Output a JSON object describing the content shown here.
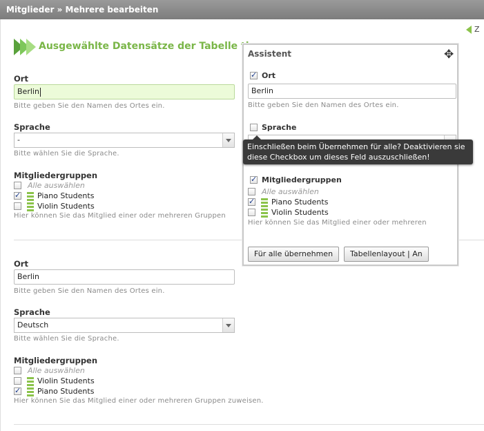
{
  "header": {
    "title": "Mitglieder » Mehrere bearbeiten"
  },
  "back_link": {
    "label": "Z"
  },
  "section": {
    "title": "Ausgewählte Datensätze der Tabelle th"
  },
  "records": [
    {
      "ort_label": "Ort",
      "ort_value": "Berlin",
      "ort_hint": "Bitte geben Sie den Namen des Ortes ein.",
      "sprache_label": "Sprache",
      "sprache_value": "-",
      "sprache_hint": "Bitte wählen Sie die Sprache.",
      "gruppen_label": "Mitgliedergruppen",
      "select_all": "Alle auswählen",
      "groups": [
        {
          "name": "Piano Students",
          "checked": true
        },
        {
          "name": "Violin Students",
          "checked": false
        }
      ],
      "gruppen_hint": "Hier können Sie das Mitglied einer oder mehreren Gruppen"
    },
    {
      "ort_label": "Ort",
      "ort_value": "Berlin",
      "ort_hint": "Bitte geben Sie den Namen des Ortes ein.",
      "sprache_label": "Sprache",
      "sprache_value": "Deutsch",
      "sprache_hint": "Bitte wählen Sie die Sprache.",
      "gruppen_label": "Mitgliedergruppen",
      "select_all": "Alle auswählen",
      "groups": [
        {
          "name": "Violin Students",
          "checked": false
        },
        {
          "name": "Piano Students",
          "checked": true
        }
      ],
      "gruppen_hint": "Hier können Sie das Mitglied einer oder mehreren Gruppen zuweisen."
    }
  ],
  "assistant": {
    "title": "Assistent",
    "ort_label": "Ort",
    "ort_checked": true,
    "ort_value": "Berlin",
    "ort_hint": "Bitte geben Sie den Namen des Ortes ein.",
    "sprache_label": "Sprache",
    "sprache_checked": false,
    "gruppen_label": "Mitgliedergruppen",
    "gruppen_checked": true,
    "select_all": "Alle auswählen",
    "groups": [
      {
        "name": "Piano Students",
        "checked": true
      },
      {
        "name": "Violin Students",
        "checked": false
      }
    ],
    "gruppen_hint": "Hier können Sie das Mitglied einer oder mehreren",
    "apply_all_button": "Für alle übernehmen",
    "layout_button": "Tabellenlayout | An"
  },
  "tooltip": {
    "text": "Einschließen beim Übernehmen für alle? Deaktivieren sie diese Checkbox um dieses Feld auszuschließen!"
  },
  "colors": {
    "accent": "#7ab648",
    "titlebar": "#888888",
    "tooltip_bg": "#3a3a3a"
  },
  "icons": [
    "arrow-left-icon",
    "section-arrows-icon",
    "group-icon",
    "move-icon"
  ]
}
